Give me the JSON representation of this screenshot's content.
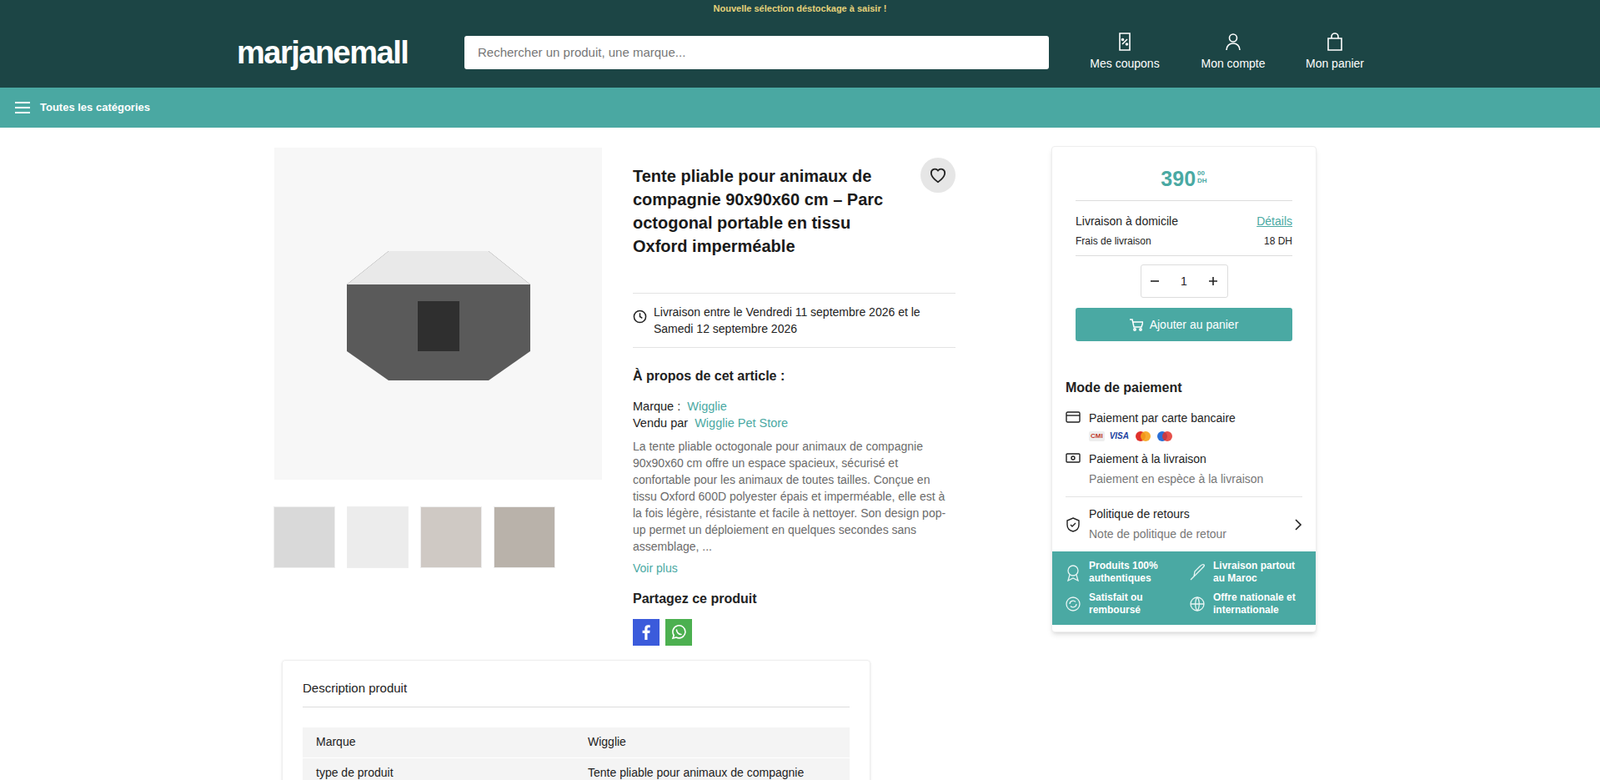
{
  "banner": "Nouvelle sélection déstockage à saisir !",
  "header": {
    "logo": "marjanemall",
    "search_placeholder": "Rechercher un produit, une marque...",
    "actions": [
      "Mes coupons",
      "Mon compte",
      "Mon panier"
    ]
  },
  "category_bar": {
    "label": "Toutes les catégories"
  },
  "gallery": {
    "thumbnails": [
      {
        "selected": false
      },
      {
        "selected": false
      },
      {
        "selected": false
      },
      {
        "selected": false
      }
    ]
  },
  "product": {
    "title": "Tente pliable pour animaux de compagnie 90x90x60 cm – Parc octogonal portable en tissu Oxford imperméable",
    "favorite": false,
    "delivery": "Livraison entre le Vendredi 11 septembre 2026 et le Samedi 12 septembre 2026",
    "about_heading": "À propos de cet article :",
    "brand_label": "Marque :",
    "brand": "Wigglie",
    "seller_label": "Vendu par",
    "seller": "Wigglie Pet Store",
    "description": "La tente pliable octogonale pour animaux de compagnie 90x90x60 cm offre un espace spacieux, sécurisé et confortable pour les animaux de toutes tailles. Conçue en tissu Oxford 600D polyester épais et imperméable, elle est à la fois légère, résistante et facile à nettoyer. Son design pop-up permet un déploiement en quelques secondes sans assemblage, ...",
    "more": "Voir plus",
    "share_heading": "Partagez ce produit"
  },
  "buy_box": {
    "price": "390",
    "price_cents": "00",
    "currency": "DH",
    "delivery_title": "Livraison à domicile",
    "details": "Détails",
    "fee_label": "Frais de livraison",
    "fee": "18 DH",
    "quantity": "1",
    "add_to_cart": "Ajouter au panier"
  },
  "payment": {
    "heading": "Mode de paiement",
    "card_title": "Paiement par carte bancaire",
    "card_brands": [
      "CMI",
      "VISA"
    ],
    "cod_title": "Paiement à la livraison",
    "cod_subtitle": "Paiement en espèce à la livraison"
  },
  "returns": {
    "title": "Politique de retours",
    "subtitle": "Note de politique de retour"
  },
  "guarantees": [
    "Produits 100% authentiques",
    "Livraison partout au Maroc",
    "Satisfait ou remboursé",
    "Offre nationale et internationale"
  ],
  "description_section": {
    "heading": "Description produit",
    "rows": [
      [
        "Marque",
        "Wigglie"
      ],
      [
        "type de produit",
        "Tente pliable pour animaux de compagnie"
      ]
    ]
  }
}
